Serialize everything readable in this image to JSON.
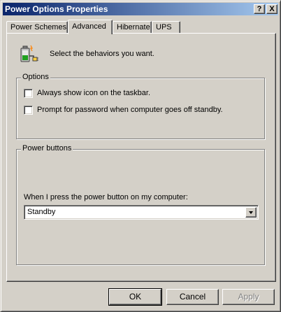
{
  "window": {
    "title": "Power Options Properties"
  },
  "titlebar_buttons": {
    "help": "?",
    "close": "X"
  },
  "tabs": [
    {
      "label": "Power Schemes",
      "active": false
    },
    {
      "label": "Advanced",
      "active": true
    },
    {
      "label": "Hibernate",
      "active": false
    },
    {
      "label": "UPS",
      "active": false
    }
  ],
  "header": {
    "text": "Select the behaviors you want.",
    "icon": "battery-plug-icon"
  },
  "options_group": {
    "label": "Options",
    "checkboxes": [
      {
        "label": "Always show icon on the taskbar.",
        "checked": false
      },
      {
        "label": "Prompt for password when computer goes off standby.",
        "checked": false
      }
    ]
  },
  "power_buttons_group": {
    "label": "Power buttons",
    "prompt": "When I press the power button on my computer:",
    "selected": "Standby"
  },
  "buttons": {
    "ok": "OK",
    "cancel": "Cancel",
    "apply": "Apply"
  }
}
